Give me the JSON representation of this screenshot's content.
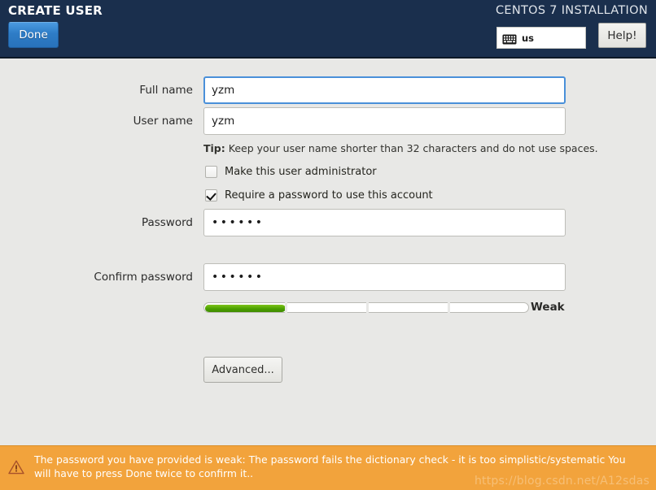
{
  "header": {
    "screen_title": "CREATE USER",
    "installation_title": "CENTOS 7 INSTALLATION",
    "done_label": "Done",
    "help_label": "Help!",
    "keyboard_layout": "us",
    "keyboard_icon": "keyboard-icon",
    "accent_color": "#2e7cc6",
    "background_color": "#1a2f4d"
  },
  "form": {
    "full_name": {
      "label": "Full name",
      "value": "yzm",
      "placeholder": "",
      "focused": true
    },
    "user_name": {
      "label": "User name",
      "value": "yzm",
      "placeholder": "",
      "focused": false
    },
    "tip": {
      "prefix": "Tip:",
      "text": " Keep your user name shorter than 32 characters and do not use spaces."
    },
    "make_admin": {
      "label": "Make this user administrator",
      "checked": false
    },
    "require_password": {
      "label": "Require a password to use this account",
      "checked": true
    },
    "password": {
      "label": "Password",
      "value": "••••••",
      "placeholder": "",
      "focused": false
    },
    "confirm_password": {
      "label": "Confirm password",
      "value": "••••••",
      "placeholder": "",
      "focused": false
    },
    "strength": {
      "label": "Weak",
      "percent": 25,
      "segments": 4,
      "fill_color": "#4ba000"
    },
    "advanced_label": "Advanced..."
  },
  "warning": {
    "icon": "warning-triangle-icon",
    "message": "The password you have provided is weak: The password fails the dictionary check - it is too simplistic/systematic You will have to press Done twice to confirm it..",
    "background_color": "#f2a33c"
  },
  "watermark": {
    "text": "https://blog.csdn.net/A12sdas"
  }
}
